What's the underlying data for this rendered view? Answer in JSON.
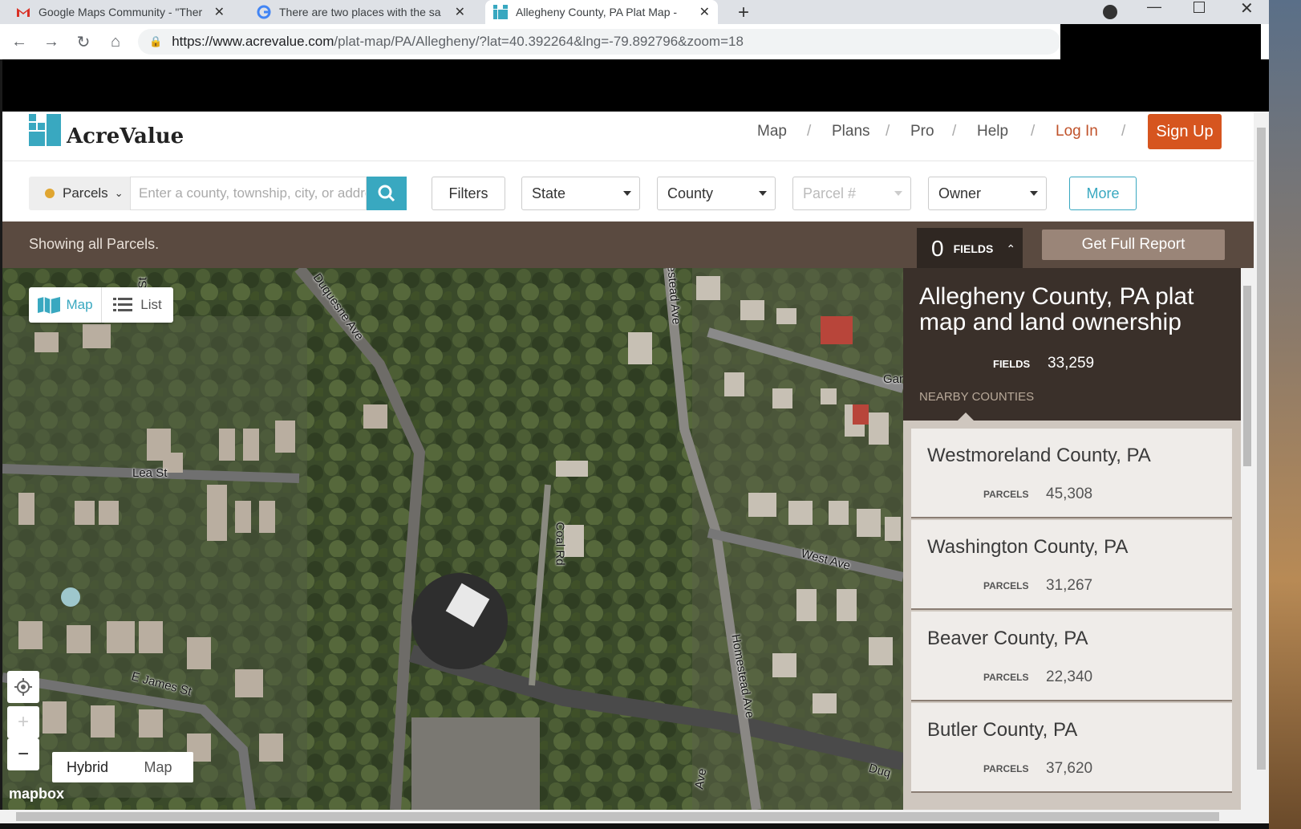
{
  "browser": {
    "tabs": [
      {
        "title": "Google Maps Community - \"Ther",
        "icon": "gmail-icon"
      },
      {
        "title": "There are two places with the sa",
        "icon": "google-icon"
      },
      {
        "title": "Allegheny County, PA Plat Map -",
        "icon": "acrevalue-icon"
      }
    ],
    "url_host": "https://www.acrevalue.com",
    "url_path": "/plat-map/PA/Allegheny/?lat=40.392264&lng=-79.892796&zoom=18"
  },
  "header": {
    "logo_text": "AcreValue",
    "nav": [
      "Map",
      "Plans",
      "Pro",
      "Help"
    ],
    "login": "Log In",
    "signup": "Sign Up"
  },
  "search": {
    "layer": "Parcels",
    "placeholder": "Enter a county, township, city, or address",
    "filters": "Filters",
    "state": "State",
    "county": "County",
    "parcel_placeholder": "Parcel #",
    "owner": "Owner",
    "more": "More"
  },
  "status": {
    "showing": "Showing all Parcels.",
    "fields_count": "0",
    "fields_label": "FIELDS",
    "full_report": "Get Full Report"
  },
  "map": {
    "view_map": "Map",
    "view_list": "List",
    "layer_hybrid": "Hybrid",
    "layer_map": "Map",
    "streets": [
      "Duquesne Ave",
      "Lea St",
      "Coal Rd",
      "Homestead Ave",
      "West Ave",
      "E James St",
      "Fr",
      "St",
      "estead Ave",
      "Gar",
      "Duq",
      "Ave"
    ],
    "attribution": "mapbox"
  },
  "sidebar": {
    "title": "Allegheny County, PA plat map and land ownership",
    "fields_label": "FIELDS",
    "fields_value": "33,259",
    "nearby_label": "NEARBY COUNTIES",
    "counties": [
      {
        "name": "Westmoreland County, PA",
        "parcels_label": "PARCELS",
        "parcels": "45,308"
      },
      {
        "name": "Washington County, PA",
        "parcels_label": "PARCELS",
        "parcels": "31,267"
      },
      {
        "name": "Beaver County, PA",
        "parcels_label": "PARCELS",
        "parcels": "22,340"
      },
      {
        "name": "Butler County, PA",
        "parcels_label": "PARCELS",
        "parcels": "37,620"
      }
    ]
  },
  "colors": {
    "accent": "#39a8c0",
    "signup": "#d6551f",
    "statusbar": "#5a4a40"
  }
}
